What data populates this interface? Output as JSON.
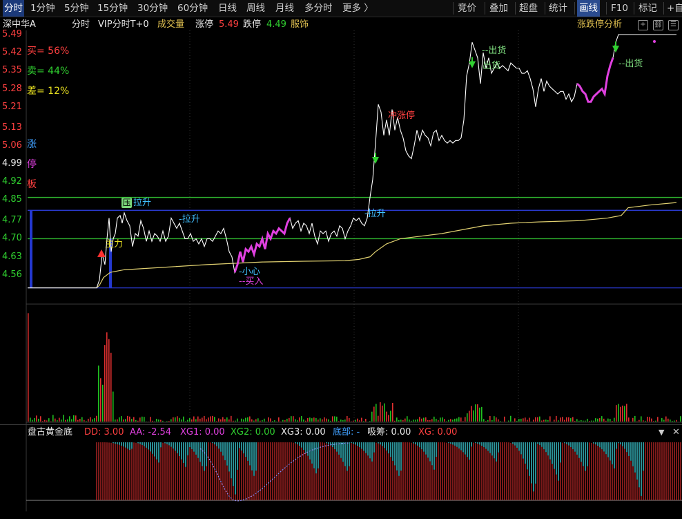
{
  "toolbar": {
    "periods": [
      "分时",
      "1分钟",
      "5分钟",
      "15分钟",
      "30分钟",
      "60分钟",
      "日线",
      "周线",
      "月线",
      "多分时",
      "更多 〉"
    ],
    "right_tabs": [
      "竞价",
      "叠加",
      "超盘",
      "统计",
      "画线",
      "F10",
      "标记",
      "+自"
    ]
  },
  "info": {
    "stock_name": "深中华A",
    "mode": "分时",
    "vip": "VIP分时T+0",
    "volume": "成交量",
    "limit_up_label": "涨停",
    "limit_up_value": "5.49",
    "limit_down_label": "跌停",
    "limit_down_value": "4.49",
    "industry": "服饰",
    "analysis": "涨跌停分析",
    "btn_plus": "+",
    "btn_chain": "⛓",
    "btn_menu": "☰"
  },
  "price_axis": [
    "5.49",
    "5.42",
    "5.35",
    "5.28",
    "5.21",
    "5.13",
    "5.06",
    "4.99",
    "4.92",
    "4.85",
    "4.77",
    "4.70",
    "4.63",
    "4.56"
  ],
  "stats": {
    "buy": "买= 56%",
    "sell": "卖= 44%",
    "diff": "差= 12%"
  },
  "side_chars": [
    "涨",
    "停",
    "板"
  ],
  "annotations": {
    "zhuli": "主力",
    "ya": "压",
    "lasheng1": "拉升",
    "lasheng2": "-拉升",
    "lasheng3": "-拉升",
    "xiaoxin": "-小心",
    "mairu": "--买入",
    "chongzhangting": "冲涨停",
    "chuhuo1": "--出货",
    "chuhuo2": "出货",
    "chuhuo3": "--出货"
  },
  "indicator": {
    "name": "盘古黄金底",
    "dd": "DD: 3.00",
    "aa": "AA: -2.54",
    "xg1": "XG1: 0.00",
    "xg2": "XG2: 0.00",
    "xg3": "XG3: 0.00",
    "dibu": "底部: -",
    "xichou": "吸筹: 0.00",
    "xg": "XG: 0.00"
  },
  "chart_data": {
    "type": "line",
    "ylim": [
      4.49,
      5.49
    ],
    "ticks": [
      "4.56",
      "4.63",
      "4.70",
      "4.77",
      "4.85",
      "4.92",
      "4.99",
      "5.06",
      "5.13",
      "5.21",
      "5.28",
      "5.35",
      "5.42",
      "5.49"
    ],
    "horizontal_lines": [
      {
        "name": "green-line-upper",
        "y": 4.86,
        "color": "#2fb82f"
      },
      {
        "name": "blue-line-upper",
        "y": 4.81,
        "color": "#2b3bd4"
      },
      {
        "name": "green-line-lower",
        "y": 4.7,
        "color": "#2fb82f"
      },
      {
        "name": "blue-line-lower",
        "y": 4.51,
        "color": "#2b3bd4"
      }
    ],
    "colors": {
      "price": "#ffffff",
      "avg": "#e0d070",
      "highlight": "#e040e0",
      "up": "#e03030",
      "down": "#20c020"
    },
    "price": [
      [
        0,
        4.51
      ],
      [
        20,
        4.51
      ],
      [
        40,
        4.51
      ],
      [
        60,
        4.51
      ],
      [
        80,
        4.51
      ],
      [
        100,
        4.51
      ],
      [
        104,
        4.54
      ],
      [
        108,
        4.64
      ],
      [
        112,
        4.6
      ],
      [
        115,
        4.7
      ],
      [
        118,
        4.78
      ],
      [
        121,
        4.65
      ],
      [
        124,
        4.7
      ],
      [
        127,
        4.72
      ],
      [
        130,
        4.78
      ],
      [
        134,
        4.79
      ],
      [
        137,
        4.76
      ],
      [
        140,
        4.8
      ],
      [
        144,
        4.77
      ],
      [
        148,
        4.75
      ],
      [
        152,
        4.67
      ],
      [
        156,
        4.72
      ],
      [
        160,
        4.71
      ],
      [
        164,
        4.77
      ],
      [
        168,
        4.74
      ],
      [
        172,
        4.69
      ],
      [
        176,
        4.73
      ],
      [
        180,
        4.69
      ],
      [
        184,
        4.72
      ],
      [
        188,
        4.71
      ],
      [
        192,
        4.69
      ],
      [
        196,
        4.73
      ],
      [
        200,
        4.69
      ],
      [
        204,
        4.71
      ],
      [
        208,
        4.78
      ],
      [
        212,
        4.76
      ],
      [
        216,
        4.74
      ],
      [
        220,
        4.76
      ],
      [
        224,
        4.73
      ],
      [
        228,
        4.7
      ],
      [
        232,
        4.7
      ],
      [
        236,
        4.72
      ],
      [
        240,
        4.69
      ],
      [
        244,
        4.7
      ],
      [
        248,
        4.68
      ],
      [
        252,
        4.7
      ],
      [
        256,
        4.67
      ],
      [
        260,
        4.7
      ],
      [
        264,
        4.7
      ],
      [
        268,
        4.69
      ],
      [
        272,
        4.71
      ],
      [
        276,
        4.73
      ],
      [
        280,
        4.72
      ],
      [
        284,
        4.74
      ],
      [
        288,
        4.7
      ],
      [
        292,
        4.65
      ],
      [
        296,
        4.63
      ],
      [
        300,
        4.57
      ],
      [
        304,
        4.6
      ],
      [
        308,
        4.65
      ],
      [
        312,
        4.61
      ],
      [
        316,
        4.66
      ],
      [
        320,
        4.65
      ],
      [
        324,
        4.67
      ],
      [
        328,
        4.64
      ],
      [
        332,
        4.68
      ],
      [
        336,
        4.67
      ],
      [
        340,
        4.7
      ],
      [
        344,
        4.66
      ],
      [
        348,
        4.72
      ],
      [
        352,
        4.7
      ],
      [
        356,
        4.73
      ],
      [
        360,
        4.72
      ],
      [
        364,
        4.74
      ],
      [
        368,
        4.73
      ],
      [
        372,
        4.72
      ],
      [
        376,
        4.76
      ],
      [
        380,
        4.78
      ],
      [
        384,
        4.74
      ],
      [
        388,
        4.76
      ],
      [
        392,
        4.77
      ],
      [
        396,
        4.73
      ],
      [
        400,
        4.76
      ],
      [
        404,
        4.75
      ],
      [
        408,
        4.72
      ],
      [
        412,
        4.76
      ],
      [
        416,
        4.71
      ],
      [
        420,
        4.68
      ],
      [
        424,
        4.73
      ],
      [
        428,
        4.72
      ],
      [
        432,
        4.73
      ],
      [
        436,
        4.69
      ],
      [
        440,
        4.72
      ],
      [
        444,
        4.73
      ],
      [
        448,
        4.71
      ],
      [
        452,
        4.75
      ],
      [
        456,
        4.74
      ],
      [
        460,
        4.7
      ],
      [
        464,
        4.73
      ],
      [
        468,
        4.75
      ],
      [
        472,
        4.78
      ],
      [
        476,
        4.77
      ],
      [
        480,
        4.78
      ],
      [
        484,
        4.76
      ],
      [
        488,
        4.75
      ],
      [
        492,
        4.78
      ],
      [
        496,
        4.86
      ],
      [
        500,
        4.93
      ],
      [
        504,
        5.07
      ],
      [
        508,
        5.22
      ],
      [
        512,
        5.19
      ],
      [
        516,
        5.1
      ],
      [
        520,
        5.16
      ],
      [
        524,
        5.1
      ],
      [
        528,
        5.2
      ],
      [
        532,
        5.12
      ],
      [
        536,
        5.17
      ],
      [
        540,
        5.12
      ],
      [
        544,
        5.09
      ],
      [
        548,
        5.04
      ],
      [
        552,
        5.02
      ],
      [
        556,
        5.01
      ],
      [
        560,
        5.06
      ],
      [
        564,
        5.12
      ],
      [
        568,
        5.08
      ],
      [
        572,
        5.12
      ],
      [
        576,
        5.1
      ],
      [
        580,
        5.09
      ],
      [
        584,
        5.06
      ],
      [
        588,
        5.11
      ],
      [
        592,
        5.12
      ],
      [
        596,
        5.08
      ],
      [
        600,
        5.1
      ],
      [
        604,
        5.08
      ],
      [
        608,
        5.07
      ],
      [
        612,
        5.08
      ],
      [
        616,
        5.07
      ],
      [
        620,
        5.08
      ],
      [
        624,
        5.08
      ],
      [
        628,
        5.09
      ],
      [
        632,
        5.16
      ],
      [
        636,
        5.33
      ],
      [
        640,
        5.38
      ],
      [
        644,
        5.46
      ],
      [
        648,
        5.43
      ],
      [
        652,
        5.4
      ],
      [
        656,
        5.3
      ],
      [
        660,
        5.42
      ],
      [
        664,
        5.36
      ],
      [
        668,
        5.4
      ],
      [
        672,
        5.34
      ],
      [
        676,
        5.36
      ],
      [
        680,
        5.38
      ],
      [
        684,
        5.36
      ],
      [
        688,
        5.37
      ],
      [
        692,
        5.36
      ],
      [
        696,
        5.35
      ],
      [
        700,
        5.38
      ],
      [
        704,
        5.37
      ],
      [
        708,
        5.36
      ],
      [
        712,
        5.36
      ],
      [
        716,
        5.34
      ],
      [
        720,
        5.34
      ],
      [
        724,
        5.35
      ],
      [
        728,
        5.32
      ],
      [
        732,
        5.28
      ],
      [
        736,
        5.21
      ],
      [
        740,
        5.28
      ],
      [
        744,
        5.32
      ],
      [
        748,
        5.27
      ],
      [
        752,
        5.31
      ],
      [
        756,
        5.29
      ],
      [
        760,
        5.28
      ],
      [
        764,
        5.27
      ],
      [
        768,
        5.26
      ],
      [
        772,
        5.27
      ],
      [
        776,
        5.27
      ],
      [
        780,
        5.24
      ],
      [
        784,
        5.26
      ],
      [
        788,
        5.23
      ],
      [
        792,
        5.25
      ],
      [
        796,
        5.3
      ],
      [
        800,
        5.29
      ],
      [
        804,
        5.27
      ],
      [
        808,
        5.26
      ],
      [
        812,
        5.23
      ],
      [
        816,
        5.23
      ],
      [
        820,
        5.25
      ],
      [
        824,
        5.26
      ],
      [
        828,
        5.27
      ],
      [
        832,
        5.28
      ],
      [
        836,
        5.26
      ],
      [
        840,
        5.33
      ],
      [
        844,
        5.37
      ],
      [
        848,
        5.4
      ],
      [
        852,
        5.46
      ],
      [
        856,
        5.49
      ],
      [
        860,
        5.49
      ],
      [
        880,
        5.49
      ],
      [
        900,
        5.49
      ],
      [
        920,
        5.49
      ],
      [
        940,
        5.49
      ]
    ],
    "avg_price": [
      [
        0,
        4.51
      ],
      [
        100,
        4.51
      ],
      [
        104,
        4.52
      ],
      [
        110,
        4.55
      ],
      [
        120,
        4.57
      ],
      [
        140,
        4.58
      ],
      [
        200,
        4.59
      ],
      [
        260,
        4.6
      ],
      [
        300,
        4.605
      ],
      [
        340,
        4.61
      ],
      [
        400,
        4.613
      ],
      [
        460,
        4.615
      ],
      [
        480,
        4.62
      ],
      [
        496,
        4.63
      ],
      [
        504,
        4.65
      ],
      [
        520,
        4.68
      ],
      [
        540,
        4.7
      ],
      [
        600,
        4.72
      ],
      [
        640,
        4.74
      ],
      [
        660,
        4.75
      ],
      [
        700,
        4.76
      ],
      [
        740,
        4.765
      ],
      [
        800,
        4.77
      ],
      [
        840,
        4.78
      ],
      [
        860,
        4.79
      ],
      [
        870,
        4.82
      ],
      [
        900,
        4.83
      ],
      [
        940,
        4.84
      ]
    ],
    "highlight_ranges": [
      [
        300,
        380
      ],
      [
        796,
        848
      ]
    ],
    "volume_note": "volume bars colored red/green per minute, ylim [0, 100]"
  }
}
